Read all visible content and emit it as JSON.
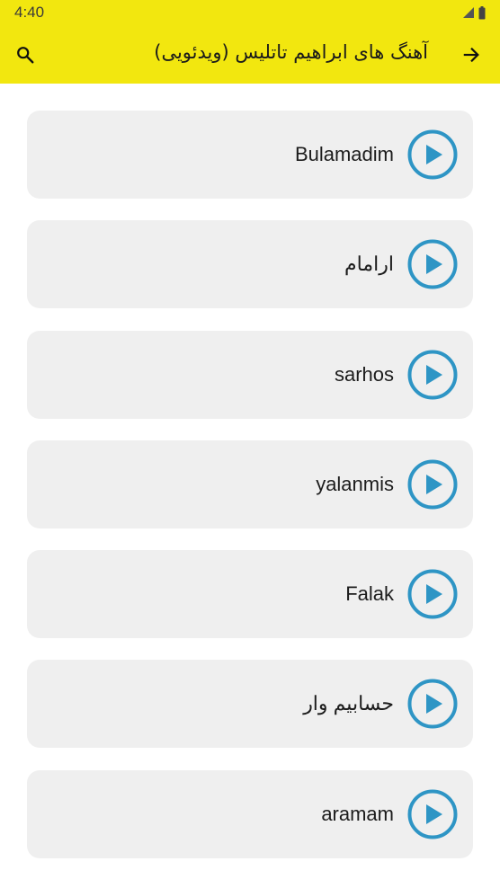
{
  "status_bar": {
    "time": "4:40",
    "signal_icon": "cell-signal-icon",
    "battery_icon": "battery-icon"
  },
  "app_bar": {
    "title": "آهنگ های ابراهیم تاتلیس (ویدئویی)",
    "search_icon": "search-icon",
    "back_icon": "arrow-forward-icon",
    "background": "#f2e70f"
  },
  "songs": [
    {
      "title": "Bulamadim"
    },
    {
      "title": "ارامام"
    },
    {
      "title": "sarhos"
    },
    {
      "title": "yalanmis"
    },
    {
      "title": "Falak"
    },
    {
      "title": "حسابیم وار"
    },
    {
      "title": "aramam"
    }
  ],
  "colors": {
    "accent": "#2e95c5",
    "card_bg": "#efefef"
  }
}
